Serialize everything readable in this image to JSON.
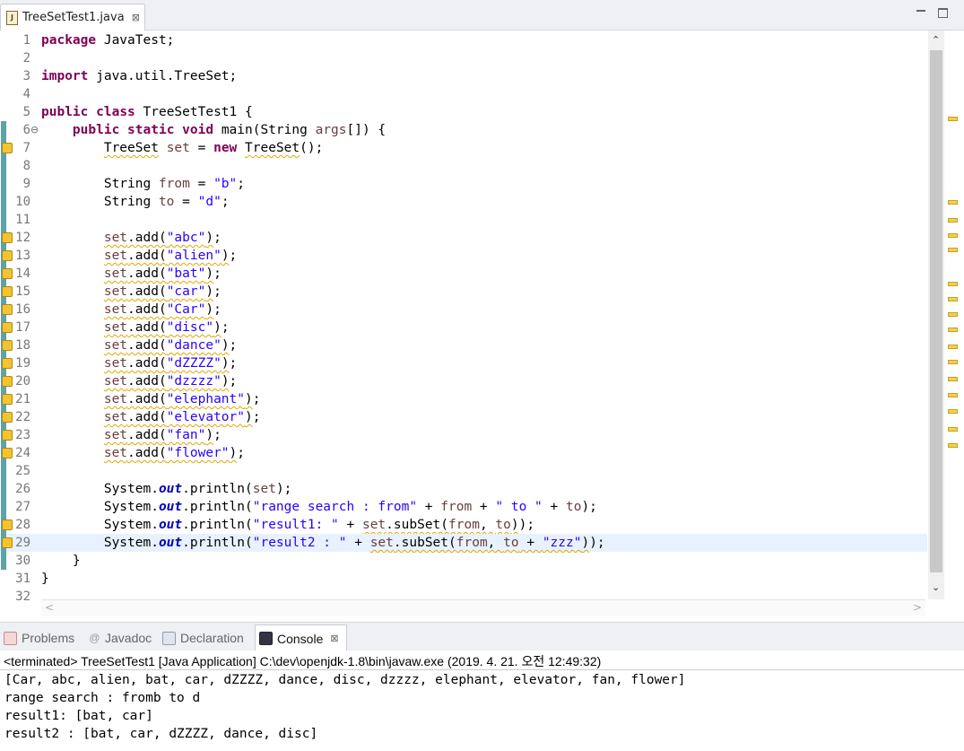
{
  "editor_tab": {
    "title": "TreeSetTest1.java",
    "close": "⊠"
  },
  "code_lines": [
    {
      "n": "1",
      "html": "<span class='kw'>package</span> JavaTest;"
    },
    {
      "n": "2",
      "html": ""
    },
    {
      "n": "3",
      "html": "<span class='kw'>import</span> java.util.TreeSet;"
    },
    {
      "n": "4",
      "html": ""
    },
    {
      "n": "5",
      "html": "<span class='kw'>public</span> <span class='kw'>class</span> TreeSetTest1 {"
    },
    {
      "n": "6",
      "html": "    <span class='kw'>public</span> <span class='kw'>static</span> <span class='kw'>void</span> main(String <span class='var'>args</span>[]) {",
      "fold": "⊖"
    },
    {
      "n": "7",
      "html": "        <span class='wav'>TreeSet</span> <span class='var'>set</span> = <span class='kw'>new</span> <span class='wav'>TreeSet</span>();"
    },
    {
      "n": "8",
      "html": ""
    },
    {
      "n": "9",
      "html": "        String <span class='var'>from</span> = <span class='str'>\"b\"</span>;"
    },
    {
      "n": "10",
      "html": "        String <span class='var'>to</span> = <span class='str'>\"d\"</span>;"
    },
    {
      "n": "11",
      "html": ""
    },
    {
      "n": "12",
      "html": "        <span class='wav'><span class='var'>set</span>.add(<span class='str'>\"abc\"</span>)</span>;"
    },
    {
      "n": "13",
      "html": "        <span class='wav'><span class='var'>set</span>.add(<span class='str'>\"alien\"</span>)</span>;"
    },
    {
      "n": "14",
      "html": "        <span class='wav'><span class='var'>set</span>.add(<span class='str'>\"bat\"</span>)</span>;"
    },
    {
      "n": "15",
      "html": "        <span class='wav'><span class='var'>set</span>.add(<span class='str'>\"car\"</span>)</span>;"
    },
    {
      "n": "16",
      "html": "        <span class='wav'><span class='var'>set</span>.add(<span class='str'>\"Car\"</span>)</span>;"
    },
    {
      "n": "17",
      "html": "        <span class='wav'><span class='var'>set</span>.add(<span class='str'>\"disc\"</span>)</span>;"
    },
    {
      "n": "18",
      "html": "        <span class='wav'><span class='var'>set</span>.add(<span class='str'>\"dance\"</span>)</span>;"
    },
    {
      "n": "19",
      "html": "        <span class='wav'><span class='var'>set</span>.add(<span class='str'>\"dZZZZ\"</span>)</span>;"
    },
    {
      "n": "20",
      "html": "        <span class='wav'><span class='var'>set</span>.add(<span class='str'>\"dzzzz\"</span>)</span>;"
    },
    {
      "n": "21",
      "html": "        <span class='wav'><span class='var'>set</span>.add(<span class='str'>\"elephant\"</span>)</span>;"
    },
    {
      "n": "22",
      "html": "        <span class='wav'><span class='var'>set</span>.add(<span class='str'>\"elevator\"</span>)</span>;"
    },
    {
      "n": "23",
      "html": "        <span class='wav'><span class='var'>set</span>.add(<span class='str'>\"fan\"</span>)</span>;"
    },
    {
      "n": "24",
      "html": "        <span class='wav'><span class='var'>set</span>.add(<span class='str'>\"flower\"</span>)</span>;"
    },
    {
      "n": "25",
      "html": ""
    },
    {
      "n": "26",
      "html": "        System.<span class='stat'>out</span>.println(<span class='var'>set</span>);"
    },
    {
      "n": "27",
      "html": "        System.<span class='stat'>out</span>.println(<span class='str'>\"range search : from\"</span> + <span class='var'>from</span> + <span class='str'>\" to \"</span> + <span class='var'>to</span>);"
    },
    {
      "n": "28",
      "html": "        System.<span class='stat'>out</span>.println(<span class='str'>\"result1: \"</span> + <span class='wav'><span class='var'>set</span>.subSet(<span class='var'>from</span>, <span class='var'>to</span>)</span>);"
    },
    {
      "n": "29",
      "html": "        System.<span class='stat'>out</span>.println(<span class='str'>\"result2 : \"</span> + <span class='wav'><span class='var'>set</span>.subSet(<span class='var'>from</span>, <span class='var'>to</span> + <span class='str'>\"zzz\"</span>)</span>);"
    },
    {
      "n": "30",
      "html": "    }"
    },
    {
      "n": "31",
      "html": "}"
    },
    {
      "n": "32",
      "html": ""
    }
  ],
  "panel_tabs": {
    "problems": "Problems",
    "javadoc": "Javadoc",
    "declaration": "Declaration",
    "console": "Console",
    "console_close": "⊠"
  },
  "console": {
    "status": "<terminated> TreeSetTest1 [Java Application] C:\\dev\\openjdk-1.8\\bin\\javaw.exe (2019. 4. 21. 오전 12:49:32)",
    "lines": [
      "[Car, abc, alien, bat, car, dZZZZ, dance, disc, dzzzz, elephant, elevator, fan, flower]",
      "range search : fromb to d",
      "result1: [bat, car]",
      "result2 : [bat, car, dZZZZ, dance, disc]"
    ]
  },
  "colors": {
    "keyword": "#7f0055",
    "string": "#2a00ff",
    "variable": "#6a3e3e",
    "static_field": "#0000c0",
    "current_line": "#e8f2fe"
  }
}
